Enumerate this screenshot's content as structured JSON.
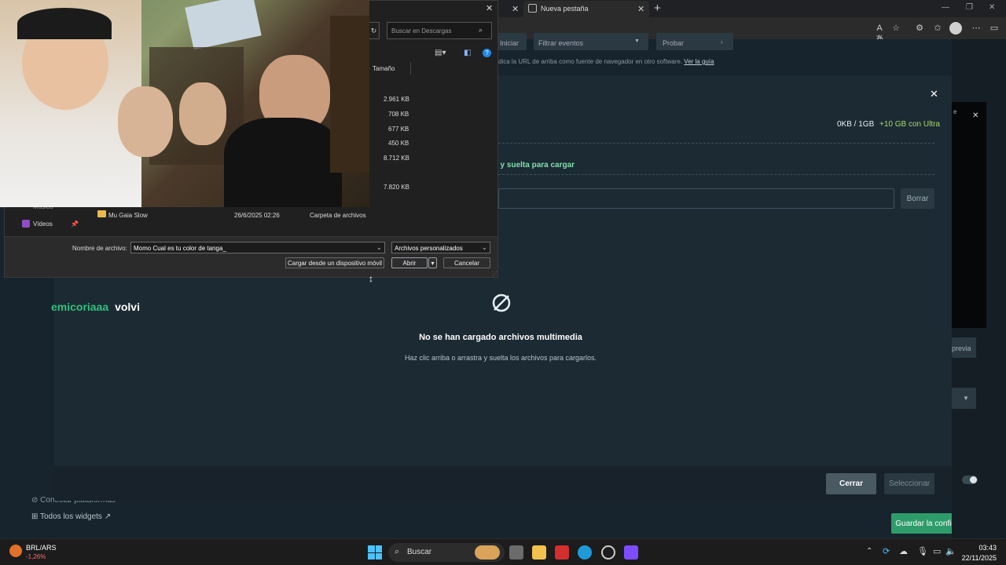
{
  "browser": {
    "tabs": [
      {
        "label": ""
      },
      {
        "label": "Nueva pestaña"
      }
    ],
    "new_tab_symbol": "+",
    "window_controls": {
      "minimize": "—",
      "restore": "❐",
      "close": "✕"
    }
  },
  "background_page": {
    "filter_buttons": [
      "Iniciar",
      "Filtrar eventos",
      "Probar"
    ],
    "hint_text": "dica la URL de arriba como fuente de navegador en otro software.",
    "hint_link": "Ver la guía",
    "sidebar_links": [
      "Conectar plataformas",
      "Todos los widgets"
    ],
    "side_panel_label": "e",
    "preview_button": "previa",
    "save_button": "Guardar la configuración"
  },
  "modal": {
    "storage_used": "0KB / 1GB",
    "storage_upgrade": "+10 GB con Ultra",
    "drop_hint": "tra y suelta para cargar",
    "delete_button": "Borrar",
    "empty_title": "No se han cargado archivos multimedia",
    "empty_subtitle": "Haz clic arriba o arrastra y suelta los archivos para cargarlos.",
    "close_button": "Cerrar",
    "select_button": "Seleccionar"
  },
  "overlay_text": {
    "user": "emicoriaaa",
    "message": "volvi"
  },
  "file_dialog": {
    "search_placeholder": "Buscar en Descargas",
    "column_size": "Tamaño",
    "sizes": [
      "2.961 KB",
      "708 KB",
      "677 KB",
      "450 KB",
      "8.712 KB",
      "7.820 KB"
    ],
    "nav_items": [
      "Música",
      "Vídeos"
    ],
    "folder_row": {
      "name": "Mu Gaia Slow",
      "date": "26/6/2025 02:26",
      "type": "Carpeta de archivos"
    },
    "filename_label": "Nombre de archivo:",
    "filename_value": "Momo  Cual es tu color de tanga_",
    "filter_value": "Archivos personalizados",
    "mobile_button": "Cargar desde un dispositivo móvil",
    "open_button": "Abrir",
    "cancel_button": "Cancelar"
  },
  "taskbar": {
    "ticker_name": "BRL/ARS",
    "ticker_change": "-1,26%",
    "search_label": "Buscar",
    "time": "03:43",
    "date": "22/11/2025"
  },
  "colors": {
    "accent_green": "#2ec07b",
    "upgrade_text": "#a7d96b",
    "save_button_bg": "#2e9c6a"
  }
}
